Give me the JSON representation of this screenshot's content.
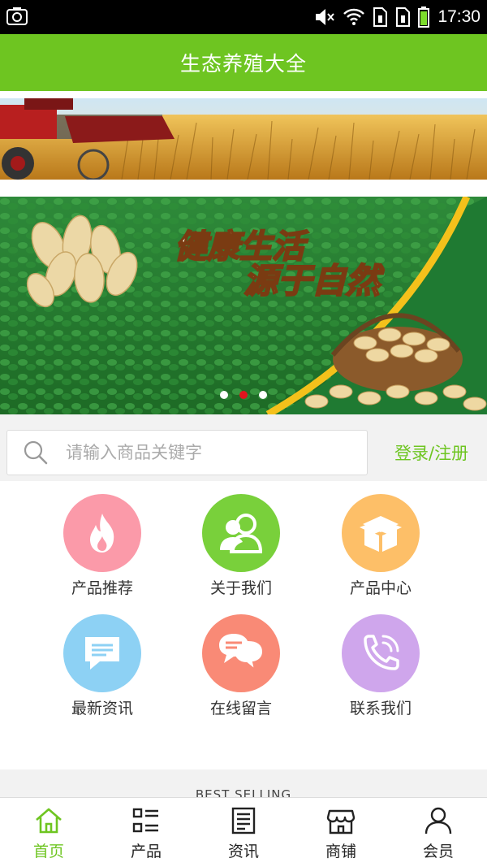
{
  "status_bar": {
    "time": "17:30"
  },
  "header": {
    "title": "生态养殖大全"
  },
  "banner": {
    "slogan_line1": "健康生活",
    "slogan_line2": "源于自然",
    "active_dot": 1
  },
  "search": {
    "placeholder": "请输入商品关键字",
    "login_label": "登录/注册"
  },
  "grid": {
    "items": [
      {
        "label": "产品推荐",
        "color": "#fb9aa9",
        "icon": "flame-icon"
      },
      {
        "label": "关于我们",
        "color": "#79d03b",
        "icon": "users-icon"
      },
      {
        "label": "产品中心",
        "color": "#fdbf68",
        "icon": "box-icon"
      },
      {
        "label": "最新资讯",
        "color": "#8dd1f4",
        "icon": "message-icon"
      },
      {
        "label": "在线留言",
        "color": "#f98a76",
        "icon": "chat-icon"
      },
      {
        "label": "联系我们",
        "color": "#cfa6ec",
        "icon": "phone-icon"
      }
    ]
  },
  "section": {
    "best_selling": "BEST SELLING"
  },
  "tabbar": {
    "tabs": [
      {
        "label": "首页",
        "icon": "home-icon",
        "active": true
      },
      {
        "label": "产品",
        "icon": "list-icon",
        "active": false
      },
      {
        "label": "资讯",
        "icon": "news-icon",
        "active": false
      },
      {
        "label": "商铺",
        "icon": "shop-icon",
        "active": false
      },
      {
        "label": "会员",
        "icon": "user-icon",
        "active": false
      }
    ]
  },
  "colors": {
    "brand_green": "#6ec521",
    "dot_active": "#e0141e"
  }
}
